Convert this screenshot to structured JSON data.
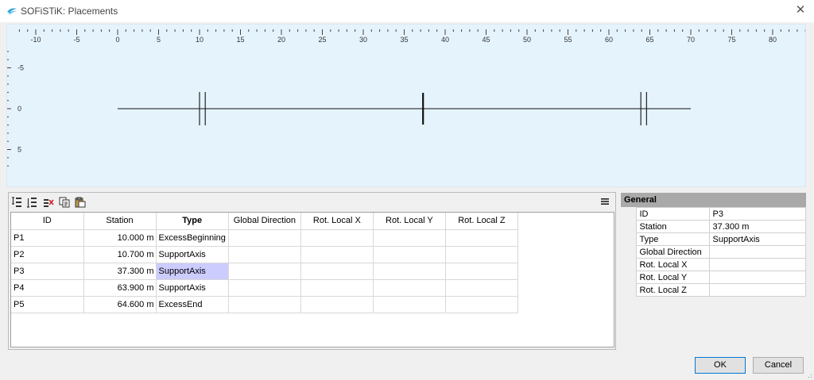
{
  "window": {
    "title": "SOFiSTiK: Placements",
    "close_label": "✕"
  },
  "viewport": {
    "x_ticks": [
      "-10",
      "-5",
      "0",
      "5",
      "10",
      "15",
      "20",
      "25",
      "30",
      "35",
      "40",
      "45",
      "50",
      "55",
      "60",
      "65",
      "70",
      "75",
      "80"
    ],
    "y_ticks": [
      "-5",
      "0",
      "5"
    ],
    "axis_range": [
      0,
      70
    ],
    "double_markers": [
      10.0,
      10.7,
      63.9,
      64.6
    ],
    "single_markers": [
      37.3
    ]
  },
  "toolbar": {
    "items": [
      "insert-row-above-icon",
      "insert-row-below-icon",
      "delete-row-icon",
      "copy-icon",
      "paste-icon"
    ],
    "menu_icon": "hamburger-menu-icon"
  },
  "grid": {
    "columns": [
      "ID",
      "Station",
      "Type",
      "Global Direction",
      "Rot. Local X",
      "Rot. Local Y",
      "Rot. Local Z"
    ],
    "rows": [
      {
        "id": "P1",
        "station": "10.000 m",
        "type": "ExcessBeginning",
        "global_direction": "",
        "rot_x": "",
        "rot_y": "",
        "rot_z": ""
      },
      {
        "id": "P2",
        "station": "10.700 m",
        "type": "SupportAxis",
        "global_direction": "",
        "rot_x": "",
        "rot_y": "",
        "rot_z": ""
      },
      {
        "id": "P3",
        "station": "37.300 m",
        "type": "SupportAxis",
        "global_direction": "",
        "rot_x": "",
        "rot_y": "",
        "rot_z": ""
      },
      {
        "id": "P4",
        "station": "63.900 m",
        "type": "SupportAxis",
        "global_direction": "",
        "rot_x": "",
        "rot_y": "",
        "rot_z": ""
      },
      {
        "id": "P5",
        "station": "64.600 m",
        "type": "ExcessEnd",
        "global_direction": "",
        "rot_x": "",
        "rot_y": "",
        "rot_z": ""
      }
    ],
    "selected_cell": {
      "row": 2,
      "column": "Type"
    },
    "selection_color": "#ccccff"
  },
  "properties": {
    "header": "General",
    "rows": [
      {
        "key": "ID",
        "value": "P3"
      },
      {
        "key": "Station",
        "value": "37.300 m"
      },
      {
        "key": "Type",
        "value": "SupportAxis"
      },
      {
        "key": "Global Direction",
        "value": ""
      },
      {
        "key": "Rot. Local X",
        "value": ""
      },
      {
        "key": "Rot. Local Y",
        "value": ""
      },
      {
        "key": "Rot. Local Z",
        "value": ""
      }
    ]
  },
  "buttons": {
    "ok": "OK",
    "cancel": "Cancel"
  },
  "colors": {
    "viewport_bg": "#e5f3fd",
    "accent": "#0078d7",
    "header_gray": "#a9a9a9"
  }
}
